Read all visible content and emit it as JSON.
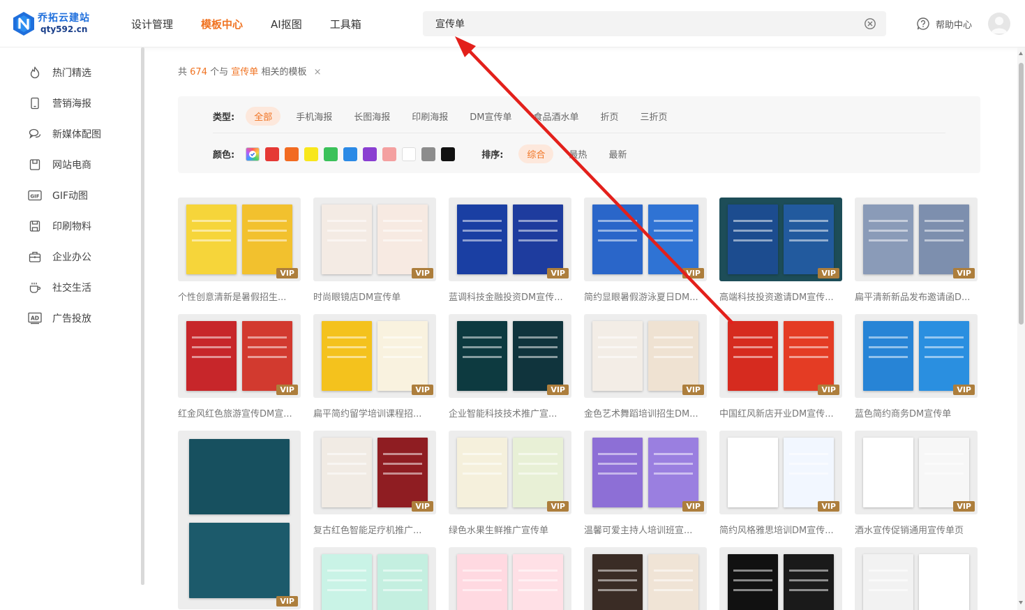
{
  "header": {
    "logo": {
      "name": "乔拓云建站",
      "domain": "qty592.cn"
    },
    "nav": [
      {
        "label": "设计管理",
        "active": false
      },
      {
        "label": "模板中心",
        "active": true
      },
      {
        "label": "AI抠图",
        "active": false
      },
      {
        "label": "工具箱",
        "active": false
      }
    ],
    "search": {
      "value": "宣传单"
    },
    "help_label": "帮助中心"
  },
  "sidebar": {
    "items": [
      {
        "label": "热门精选",
        "icon": "flame-icon"
      },
      {
        "label": "营销海报",
        "icon": "phone-icon"
      },
      {
        "label": "新媒体配图",
        "icon": "chat-icon"
      },
      {
        "label": "网站电商",
        "icon": "bag-icon"
      },
      {
        "label": "GIF动图",
        "icon": "gif-icon"
      },
      {
        "label": "印刷物料",
        "icon": "print-icon"
      },
      {
        "label": "企业办公",
        "icon": "briefcase-icon"
      },
      {
        "label": "社交生活",
        "icon": "cup-icon"
      },
      {
        "label": "广告投放",
        "icon": "ad-icon"
      }
    ]
  },
  "results": {
    "prefix": "共",
    "count": "674",
    "middle": "个与",
    "keyword": "宣传单",
    "suffix": "相关的模板",
    "close": "×"
  },
  "filters": {
    "type_label": "类型:",
    "types": [
      "全部",
      "手机海报",
      "长图海报",
      "印刷海报",
      "DM宣传单",
      "食品酒水单",
      "折页",
      "三折页"
    ],
    "type_active": 0,
    "color_label": "颜色:",
    "colors": [
      "rainbow",
      "#e53935",
      "#f26b21",
      "#f8e71c",
      "#3bc15a",
      "#2b8ae6",
      "#8a3fd1",
      "#f4a0a0",
      "#ffffff",
      "#8c8c8c",
      "#111111"
    ],
    "sort_label": "排序:",
    "sorts": [
      "综合",
      "最热",
      "最新"
    ],
    "sort_active": 0
  },
  "templates": [
    {
      "title": "个性创意清新是暑假招生...",
      "vip": "VIP",
      "colors": [
        "#f6d53a",
        "#f2c12e"
      ]
    },
    {
      "title": "时尚眼镜店DM宣传单",
      "vip": "VIP",
      "colors": [
        "#f4ebe4",
        "#f7eae2"
      ]
    },
    {
      "title": "蓝调科技金融投资DM宣传...",
      "vip": "VIP",
      "colors": [
        "#1a3fa3",
        "#1e3c9e"
      ]
    },
    {
      "title": "简约显眼暑假游泳夏日DM...",
      "vip": "VIP",
      "colors": [
        "#2a66c9",
        "#2f73d4"
      ]
    },
    {
      "title": "高端科技投资邀请DM宣传...",
      "vip": "VIP",
      "colors": [
        "#1c4c8f",
        "#225a9e"
      ],
      "dark": true
    },
    {
      "title": "扁平清新新品发布邀请函D...",
      "vip": "VIP",
      "colors": [
        "#8a9bb8",
        "#7d8fae"
      ]
    },
    {
      "title": "红金风红色旅游宣传DM宣...",
      "vip": "VIP",
      "colors": [
        "#c7262a",
        "#d23a2f"
      ]
    },
    {
      "title": "扁平简约留学培训课程招...",
      "vip": "VIP",
      "colors": [
        "#f4c21d",
        "#f9f2df"
      ]
    },
    {
      "title": "企业智能科技技术推广宣...",
      "vip": "VIP",
      "colors": [
        "#0d3a40",
        "#10343d"
      ]
    },
    {
      "title": "金色艺术舞蹈培训招生DM...",
      "vip": "VIP",
      "colors": [
        "#f3ede6",
        "#efe2d2"
      ]
    },
    {
      "title": "中国红风新店开业DM宣传...",
      "vip": "VIP",
      "colors": [
        "#d62b1f",
        "#e43c24"
      ]
    },
    {
      "title": "蓝色简约商务DM宣传单",
      "vip": "VIP",
      "colors": [
        "#2784d6",
        "#2a8fe0"
      ]
    },
    {
      "title": "",
      "vip": "VIP",
      "colors": [
        "#17505f",
        "#1c5a6b"
      ],
      "tall": true
    },
    {
      "title": "复古红色智能足疗机推广...",
      "vip": "VIP",
      "colors": [
        "#f1ebe4",
        "#8f1d22"
      ]
    },
    {
      "title": "绿色水果生鲜推广宣传单",
      "vip": "VIP",
      "colors": [
        "#f5f0dc",
        "#e8f0d6"
      ]
    },
    {
      "title": "温馨可爱主持人培训班宣...",
      "vip": "VIP",
      "colors": [
        "#8d6fd6",
        "#9a7fe0"
      ]
    },
    {
      "title": "简约风格雅思培训DM宣传...",
      "vip": "VIP",
      "colors": [
        "#ffffff",
        "#f2f7ff"
      ]
    },
    {
      "title": "酒水宣传促销通用宣传单页",
      "vip": "VIP",
      "colors": [
        "#ffffff",
        "#f7f7f7"
      ]
    },
    {
      "title": "",
      "vip": "",
      "colors": [
        "#c9f3e6",
        "#c4efe0"
      ]
    },
    {
      "title": "",
      "vip": "",
      "colors": [
        "#ffd9e1",
        "#ffe0e6"
      ]
    },
    {
      "title": "",
      "vip": "",
      "colors": [
        "#3a2c25",
        "#f0e4d6"
      ]
    },
    {
      "title": "",
      "vip": "",
      "colors": [
        "#111111",
        "#1a1a1a"
      ]
    },
    {
      "title": "",
      "vip": "",
      "colors": [
        "#f2f2f2",
        "#ffffff"
      ]
    }
  ]
}
